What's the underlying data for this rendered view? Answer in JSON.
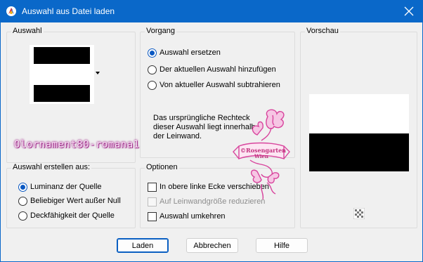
{
  "window": {
    "title": "Auswahl aus Datei laden"
  },
  "auswahl_group": {
    "label": "Auswahl"
  },
  "vorgang_group": {
    "label": "Vorgang",
    "options": [
      {
        "label": "Auswahl ersetzen",
        "selected": true
      },
      {
        "label": "Der aktuellen Auswahl hinzufügen",
        "selected": false
      },
      {
        "label": "Von aktueller Auswahl subtrahieren",
        "selected": false
      }
    ],
    "info_text": "Das ursprüngliche Rechteck dieser Auswahl liegt innerhalb der Leinwand."
  },
  "vorschau_group": {
    "label": "Vorschau"
  },
  "erstellen_group": {
    "label": "Auswahl erstellen aus:",
    "options": [
      {
        "label": "Luminanz der Quelle",
        "selected": true
      },
      {
        "label": "Beliebiger Wert außer Null",
        "selected": false
      },
      {
        "label": "Deckfähigkeit der Quelle",
        "selected": false
      }
    ]
  },
  "optionen_group": {
    "label": "Optionen",
    "checkboxes": [
      {
        "label": "In obere linke Ecke verschieben",
        "checked": false,
        "enabled": true
      },
      {
        "label": "Auf Leinwandgröße reduzieren",
        "checked": false,
        "enabled": false
      },
      {
        "label": "Auswahl umkehren",
        "checked": false,
        "enabled": true
      }
    ]
  },
  "buttons": {
    "ok": "Laden",
    "cancel": "Abbrechen",
    "help": "Hilfe"
  },
  "watermark": {
    "text": "Olornament80-romana1",
    "logo_line1": "©Rosengarten",
    "logo_line2": "Wien"
  },
  "colors": {
    "titlebar": "#0a68c9",
    "accent": "#0a58c2",
    "watermark": "#d8459d"
  }
}
